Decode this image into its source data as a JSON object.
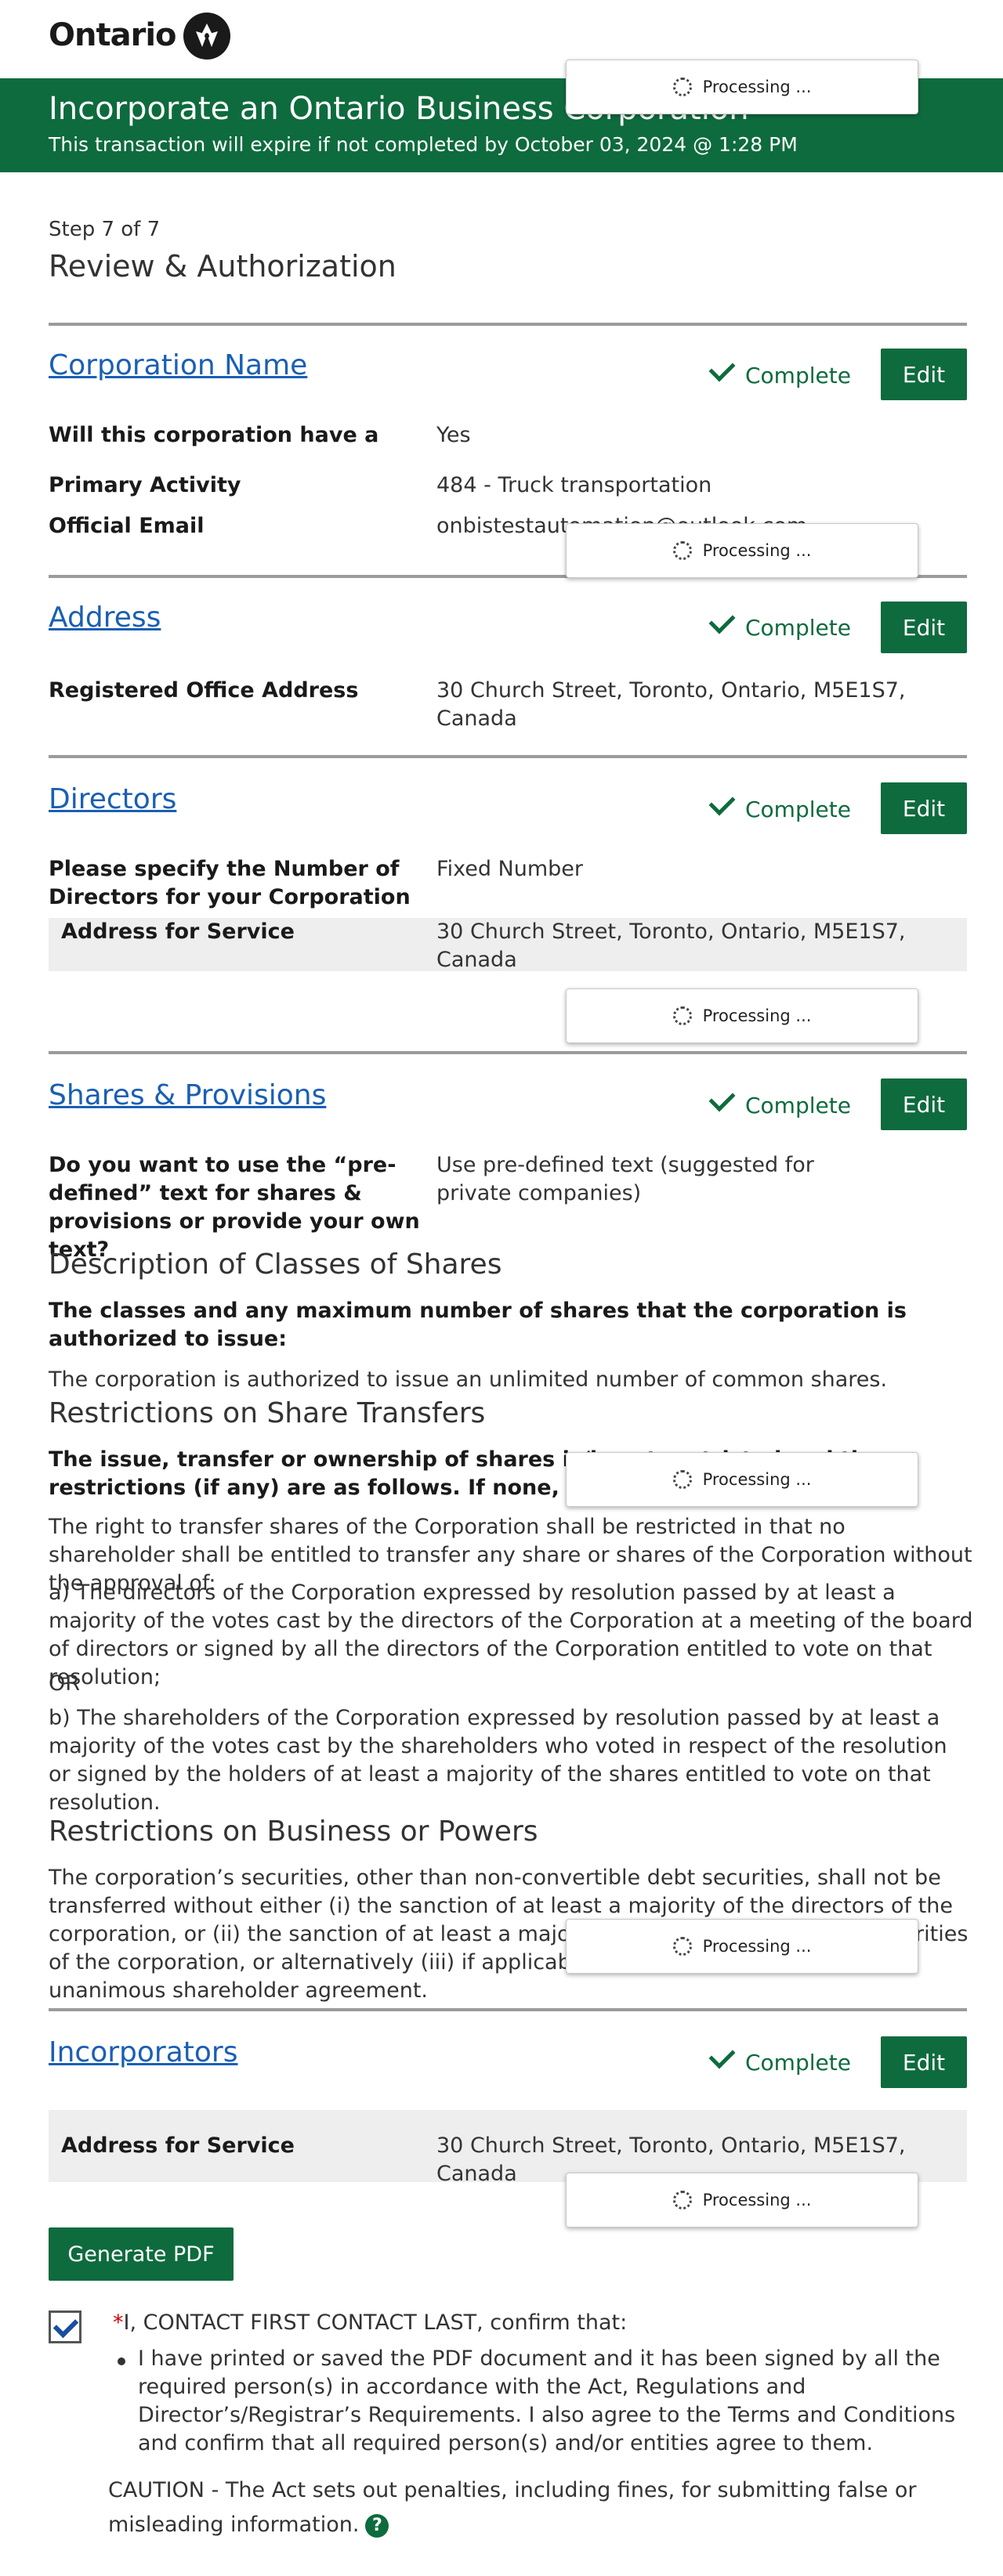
{
  "header": {
    "logo_text": "Ontario",
    "logo_icon": "trillium-icon"
  },
  "banner": {
    "title": "Incorporate an Ontario Business Corporation",
    "subtitle": "This transaction will expire if not completed by October 03, 2024 @ 1:28 PM"
  },
  "step": {
    "label": "Step 7 of 7",
    "title": "Review & Authorization"
  },
  "status": {
    "complete": "Complete",
    "edit": "Edit"
  },
  "processing": {
    "label": "Processing ..."
  },
  "corporation_name": {
    "title": "Corporation Name",
    "rows": [
      {
        "label": "Will this corporation have a number name?",
        "value": "Yes"
      },
      {
        "label": "Primary Activity",
        "value": "484 - Truck transportation"
      },
      {
        "label": "Official Email",
        "value": "onbistestautomation@outlook.com"
      }
    ]
  },
  "address": {
    "title": "Address",
    "rows": [
      {
        "label": "Registered Office Address",
        "value": "30 Church Street, Toronto, Ontario, M5E1S7, Canada"
      }
    ]
  },
  "directors": {
    "title": "Directors",
    "rows": [
      {
        "label": "Please specify the Number of Directors for your Corporation",
        "value": "Fixed Number"
      },
      {
        "label": "Address for Service",
        "value": "30 Church Street, Toronto, Ontario, M5E1S7, Canada"
      }
    ]
  },
  "shares": {
    "title": "Shares & Provisions",
    "question": "Do you want to use the “pre-defined” text for shares & provisions or provide your own text?",
    "answer": "Use pre-defined text (suggested for private companies)",
    "classes_heading": "Description of Classes of Shares",
    "classes_label": "The classes and any maximum number of shares that the corporation is authorized to issue:",
    "classes_text": "The corporation is authorized to issue an unlimited number of common shares.",
    "restrictions_heading": "Restrictions on Share Transfers",
    "restrictions_label": "The issue, transfer or ownership of shares is/is not restricted and the restrictions (if any) are as follows. If none, enter \"None\":",
    "restrictions_p1": "The right to transfer shares of the Corporation shall be restricted in that no shareholder shall be entitled to transfer any share or shares of the Corporation without the approval of:",
    "restrictions_p2": "a) The directors of the Corporation expressed by resolution passed by at least a majority of the votes cast by the directors of the Corporation at a meeting of the board of directors or signed by all the directors of the Corporation entitled to vote on that resolution;",
    "restrictions_or": "OR",
    "restrictions_p3": "b) The shareholders of the Corporation expressed by resolution passed by at least a majority of the votes cast by the shareholders who voted in respect of the resolution or signed by the holders of at least a majority of the shares entitled to vote on that resolution.",
    "business_heading": "Restrictions on Business or Powers",
    "business_text": "The corporation’s securities, other than non-convertible debt securities, shall not be transferred without either (i) the sanction of at least a majority of the directors of the corporation, or (ii) the sanction of at least a majority of the holders of voting securities of the corporation, or alternatively (iii) if applicable, the restriction contained in a unanimous shareholder agreement."
  },
  "incorporators": {
    "title": "Incorporators",
    "rows": [
      {
        "label": "Address for Service",
        "value": "30 Church Street, Toronto, Ontario, M5E1S7, Canada"
      }
    ]
  },
  "footer": {
    "generate_pdf": "Generate PDF",
    "confirm_required": "*",
    "confirm_text": "I, CONTACT FIRST CONTACT LAST, confirm that:",
    "confirm_checked": true,
    "bullet": "I have printed or saved the PDF document and it has been signed by all the required person(s) in accordance with the Act, Regulations and Director’s/Registrar’s Requirements. I also agree to the Terms and Conditions and confirm that all required person(s) and/or entities agree to them.",
    "caution": "CAUTION - The Act sets out penalties, including fines, for submitting false or misleading information.",
    "help_icon": "question-icon"
  }
}
